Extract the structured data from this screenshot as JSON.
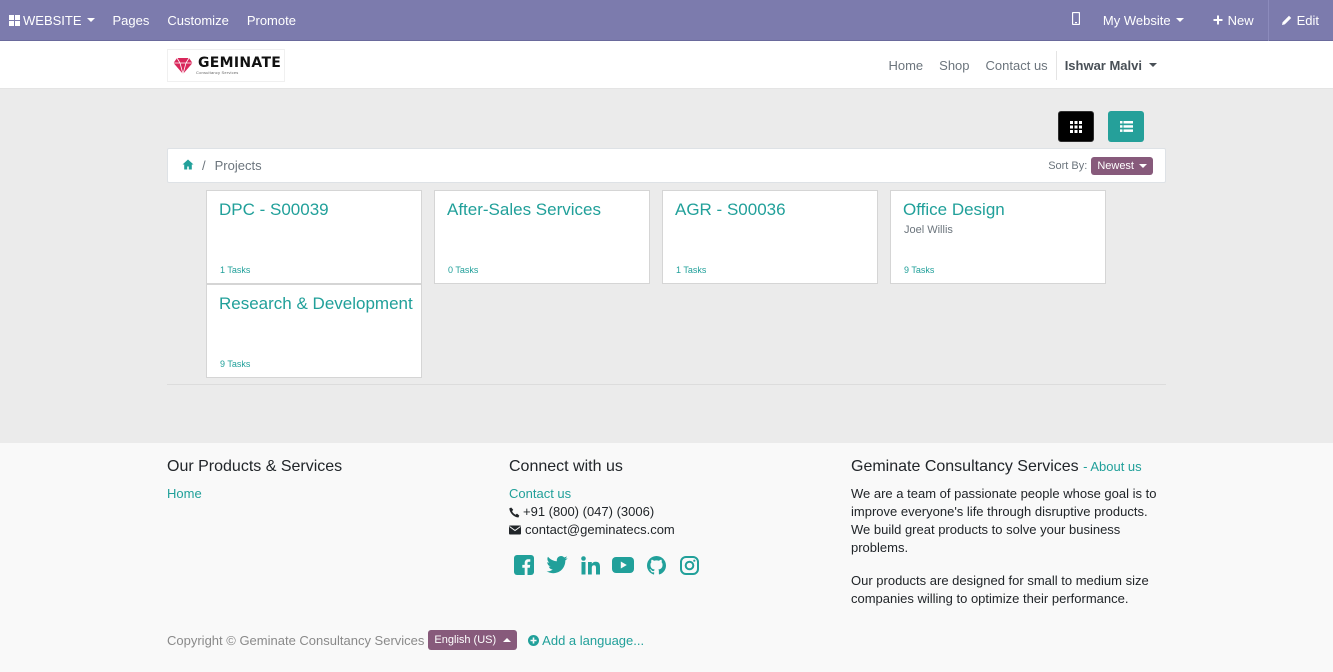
{
  "admin_bar": {
    "website_label": "WEBSITE",
    "pages": "Pages",
    "customize": "Customize",
    "promote": "Promote",
    "my_website": "My Website",
    "new": "New",
    "edit": "Edit"
  },
  "header": {
    "logo_text": "GEMINATE",
    "logo_sub": "Consultancy Services",
    "nav": [
      "Home",
      "Shop",
      "Contact us"
    ],
    "user": "Ishwar Malvi"
  },
  "breadcrumb": {
    "current": "Projects",
    "sort_label": "Sort By:",
    "sort_value": "Newest"
  },
  "projects": [
    {
      "title": "DPC - S00039",
      "subtitle": "",
      "tasks": "1 Tasks"
    },
    {
      "title": "After-Sales Services",
      "subtitle": "",
      "tasks": "0 Tasks"
    },
    {
      "title": "AGR - S00036",
      "subtitle": "",
      "tasks": "1 Tasks"
    },
    {
      "title": "Office Design",
      "subtitle": "Joel Willis",
      "tasks": "9 Tasks"
    },
    {
      "title": "Research & Development",
      "subtitle": "",
      "tasks": "9 Tasks"
    }
  ],
  "footer": {
    "products_title": "Our Products & Services",
    "products_link": "Home",
    "connect_title": "Connect with us",
    "contact_link": "Contact us",
    "phone": "+91 (800) (047) (3006)",
    "email": "contact@geminatecs.com",
    "company_title": "Geminate Consultancy Services",
    "about_link": "- About us",
    "about_p1": "We are a team of passionate people whose goal is to improve everyone's life through disruptive products. We build great products to solve your business problems.",
    "about_p2": "Our products are designed for small to medium size companies willing to optimize their performance.",
    "copyright": "Copyright © Geminate Consultancy Services",
    "language": "English (US)",
    "add_language": "Add a language..."
  },
  "colors": {
    "admin_bar": "#7c7bad",
    "accent": "#21a09a",
    "primary_badge": "#875a7b"
  },
  "icons": [
    "grid-icon",
    "mobile-icon",
    "plus-icon",
    "pencil-icon",
    "home-icon",
    "list-icon",
    "phone-icon",
    "envelope-icon",
    "facebook-icon",
    "twitter-icon",
    "linkedin-icon",
    "youtube-icon",
    "github-icon",
    "instagram-icon",
    "plus-circle-icon"
  ]
}
